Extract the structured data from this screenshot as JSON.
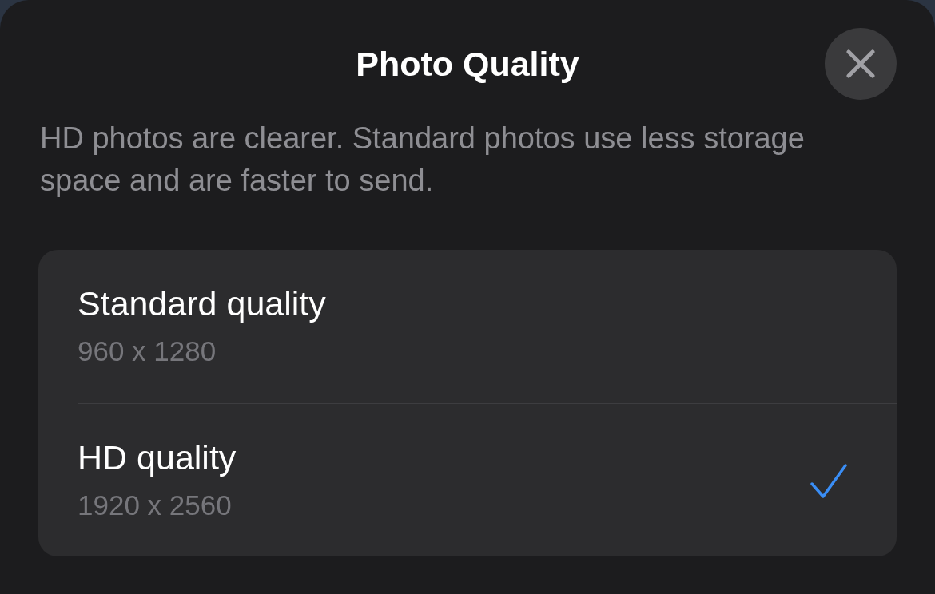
{
  "sheet": {
    "title": "Photo Quality",
    "description": "HD photos are clearer. Standard photos use less storage space and are faster to send.",
    "options": [
      {
        "label": "Standard quality",
        "resolution": "960 x 1280",
        "selected": false
      },
      {
        "label": "HD quality",
        "resolution": "1920 x 2560",
        "selected": true
      }
    ]
  }
}
